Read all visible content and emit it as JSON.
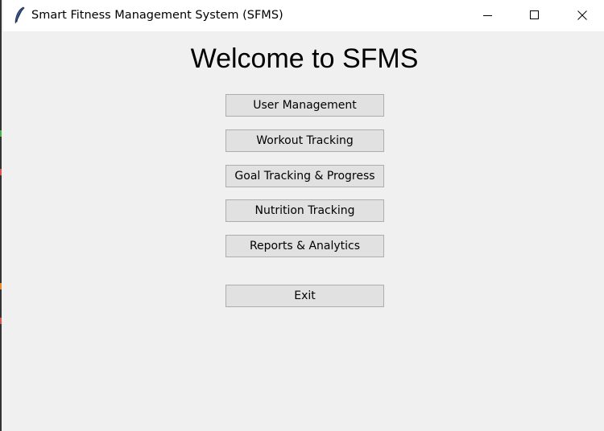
{
  "window": {
    "title": "Smart Fitness Management System (SFMS)",
    "icon": "feather-icon",
    "controls": [
      "minimize-icon",
      "maximize-icon",
      "close-icon"
    ]
  },
  "main": {
    "heading": "Welcome to SFMS",
    "buttons": [
      {
        "label": "User Management"
      },
      {
        "label": "Workout Tracking"
      },
      {
        "label": "Goal Tracking & Progress"
      },
      {
        "label": "Nutrition Tracking"
      },
      {
        "label": "Reports & Analytics"
      },
      {
        "label": "Exit"
      }
    ]
  },
  "colors": {
    "background": "#f0f0f0",
    "titlebar": "#ffffff",
    "button_face": "#e1e1e1",
    "button_border": "#adadad"
  }
}
